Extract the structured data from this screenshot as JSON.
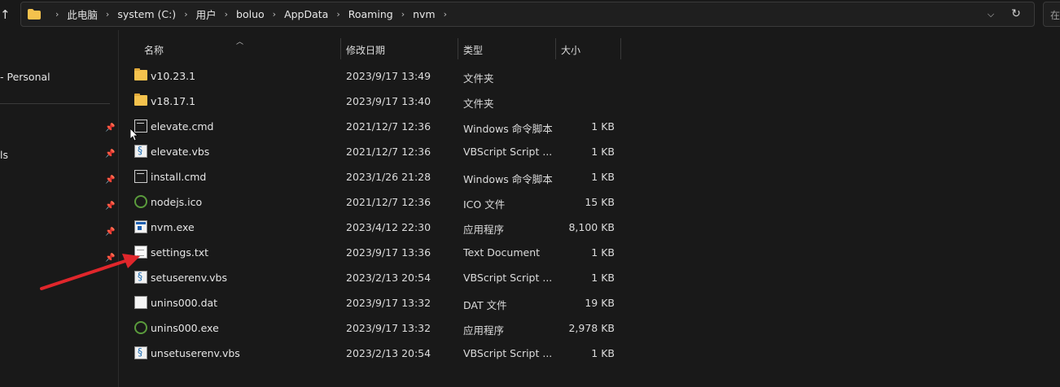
{
  "address_bar": {
    "crumbs": [
      "此电脑",
      "system (C:)",
      "用户",
      "boluo",
      "AppData",
      "Roaming",
      "nvm"
    ],
    "separator": "›"
  },
  "search": {
    "placeholder": "在"
  },
  "nav": {
    "items": [
      {
        "label": "- Personal"
      },
      {
        "label": "ls"
      }
    ]
  },
  "columns": {
    "name": "名称",
    "date": "修改日期",
    "type": "类型",
    "size": "大小"
  },
  "files": [
    {
      "icon": "folder-icon",
      "name": "v10.23.1",
      "date": "2023/9/17 13:49",
      "type": "文件夹",
      "size": ""
    },
    {
      "icon": "folder-icon",
      "name": "v18.17.1",
      "date": "2023/9/17 13:40",
      "type": "文件夹",
      "size": ""
    },
    {
      "icon": "cmd-file-icon",
      "name": "elevate.cmd",
      "date": "2021/12/7 12:36",
      "type": "Windows 命令脚本",
      "size": "1 KB"
    },
    {
      "icon": "vbs-file-icon",
      "name": "elevate.vbs",
      "date": "2021/12/7 12:36",
      "type": "VBScript Script ...",
      "size": "1 KB"
    },
    {
      "icon": "cmd-file-icon",
      "name": "install.cmd",
      "date": "2023/1/26 21:28",
      "type": "Windows 命令脚本",
      "size": "1 KB"
    },
    {
      "icon": "nodejs-icon",
      "name": "nodejs.ico",
      "date": "2021/12/7 12:36",
      "type": "ICO 文件",
      "size": "15 KB"
    },
    {
      "icon": "exe-file-icon",
      "name": "nvm.exe",
      "date": "2023/4/12 22:30",
      "type": "应用程序",
      "size": "8,100 KB"
    },
    {
      "icon": "text-file-icon",
      "name": "settings.txt",
      "date": "2023/9/17 13:36",
      "type": "Text Document",
      "size": "1 KB"
    },
    {
      "icon": "vbs-file-icon",
      "name": "setuserenv.vbs",
      "date": "2023/2/13 20:54",
      "type": "VBScript Script ...",
      "size": "1 KB"
    },
    {
      "icon": "dat-file-icon",
      "name": "unins000.dat",
      "date": "2023/9/17 13:32",
      "type": "DAT 文件",
      "size": "19 KB"
    },
    {
      "icon": "nodejs-icon",
      "name": "unins000.exe",
      "date": "2023/9/17 13:32",
      "type": "应用程序",
      "size": "2,978 KB"
    },
    {
      "icon": "vbs-file-icon",
      "name": "unsetuserenv.vbs",
      "date": "2023/2/13 20:54",
      "type": "VBScript Script ...",
      "size": "1 KB"
    }
  ],
  "colors": {
    "background": "#191919",
    "folder": "#f4c24d",
    "annotation_arrow": "#e0262b"
  }
}
